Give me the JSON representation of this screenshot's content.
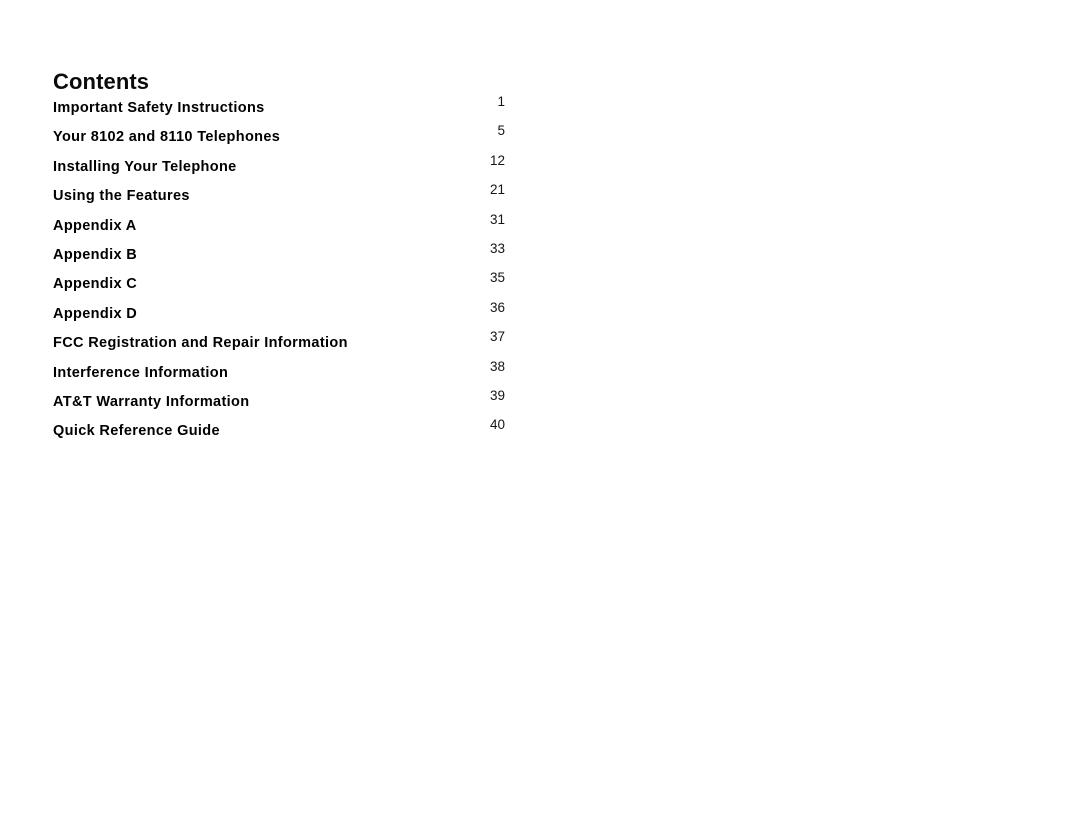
{
  "document": {
    "heading": "Contents",
    "page_background": "#ffffff",
    "text_color": "#000000"
  },
  "toc": {
    "entries": [
      {
        "label": "Important Safety Instructions",
        "page": "1"
      },
      {
        "label": "Your 8102 and 8110 Telephones",
        "page": "5"
      },
      {
        "label": "Installing Your Telephone",
        "page": "12"
      },
      {
        "label": "Using the Features",
        "page": "21"
      },
      {
        "label": "Appendix A",
        "page": "31"
      },
      {
        "label": "Appendix B",
        "page": "33"
      },
      {
        "label": "Appendix C",
        "page": "35"
      },
      {
        "label": "Appendix D",
        "page": "36"
      },
      {
        "label": "FCC Registration and Repair Information",
        "page": "37"
      },
      {
        "label": "Interference Information",
        "page": "38"
      },
      {
        "label": "AT&T Warranty Information",
        "page": "39"
      },
      {
        "label": "Quick Reference Guide",
        "page": "40"
      }
    ]
  }
}
